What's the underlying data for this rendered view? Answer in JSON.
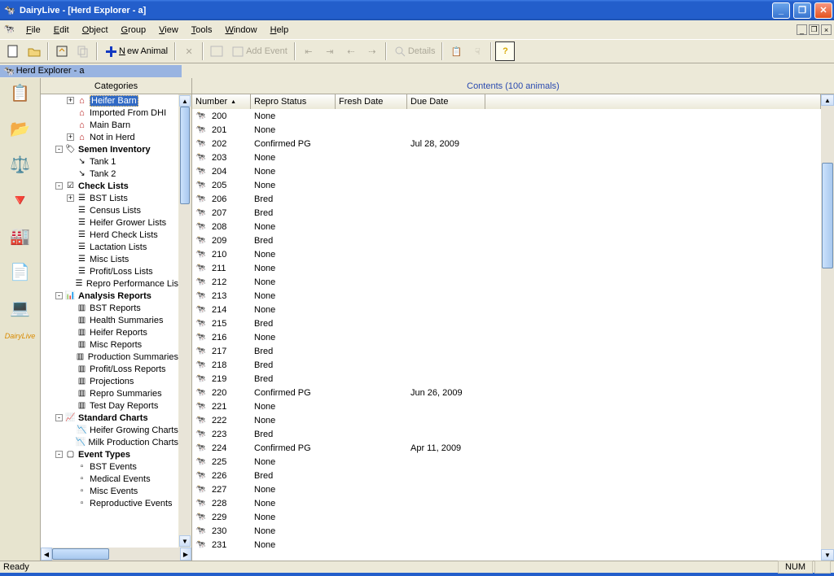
{
  "window": {
    "title": "DairyLive - [Herd Explorer - a]"
  },
  "menu": {
    "file": "File",
    "edit": "Edit",
    "object": "Object",
    "group": "Group",
    "view": "View",
    "tools": "Tools",
    "window": "Window",
    "help": "Help"
  },
  "toolbar": {
    "new_animal": "New Animal",
    "add_event": "Add Event",
    "details": "Details"
  },
  "doc": {
    "tab_title": "Herd Explorer - a"
  },
  "leftbar": {
    "label": "DairyLive"
  },
  "categories": {
    "header": "Categories",
    "nodes": [
      {
        "depth": 2,
        "exp": "+",
        "icon": "barn",
        "label": "Heifer Barn",
        "sel": true
      },
      {
        "depth": 2,
        "exp": "",
        "icon": "barn",
        "label": "Imported From DHI"
      },
      {
        "depth": 2,
        "exp": "",
        "icon": "barn",
        "label": "Main Barn"
      },
      {
        "depth": 2,
        "exp": "+",
        "icon": "barn",
        "label": "Not in Herd"
      },
      {
        "depth": 1,
        "exp": "-",
        "icon": "tag",
        "label": "Semen Inventory",
        "bold": true
      },
      {
        "depth": 2,
        "exp": "",
        "icon": "tank",
        "label": "Tank 1"
      },
      {
        "depth": 2,
        "exp": "",
        "icon": "tank",
        "label": "Tank 2"
      },
      {
        "depth": 1,
        "exp": "-",
        "icon": "check",
        "label": "Check Lists",
        "bold": true
      },
      {
        "depth": 2,
        "exp": "+",
        "icon": "list",
        "label": "BST Lists"
      },
      {
        "depth": 2,
        "exp": "",
        "icon": "list",
        "label": "Census Lists"
      },
      {
        "depth": 2,
        "exp": "",
        "icon": "list",
        "label": "Heifer Grower Lists"
      },
      {
        "depth": 2,
        "exp": "",
        "icon": "list",
        "label": "Herd Check Lists"
      },
      {
        "depth": 2,
        "exp": "",
        "icon": "list",
        "label": "Lactation Lists"
      },
      {
        "depth": 2,
        "exp": "",
        "icon": "list",
        "label": "Misc Lists"
      },
      {
        "depth": 2,
        "exp": "",
        "icon": "list",
        "label": "Profit/Loss Lists"
      },
      {
        "depth": 2,
        "exp": "",
        "icon": "list",
        "label": "Repro Performance Lis"
      },
      {
        "depth": 1,
        "exp": "-",
        "icon": "report",
        "label": "Analysis Reports",
        "bold": true
      },
      {
        "depth": 2,
        "exp": "",
        "icon": "rep",
        "label": "BST Reports"
      },
      {
        "depth": 2,
        "exp": "",
        "icon": "rep",
        "label": "Health Summaries"
      },
      {
        "depth": 2,
        "exp": "",
        "icon": "rep",
        "label": "Heifer Reports"
      },
      {
        "depth": 2,
        "exp": "",
        "icon": "rep",
        "label": "Misc Reports"
      },
      {
        "depth": 2,
        "exp": "",
        "icon": "rep",
        "label": "Production Summaries"
      },
      {
        "depth": 2,
        "exp": "",
        "icon": "rep",
        "label": "Profit/Loss Reports"
      },
      {
        "depth": 2,
        "exp": "",
        "icon": "rep",
        "label": "Projections"
      },
      {
        "depth": 2,
        "exp": "",
        "icon": "rep",
        "label": "Repro Summaries"
      },
      {
        "depth": 2,
        "exp": "",
        "icon": "rep",
        "label": "Test Day Reports"
      },
      {
        "depth": 1,
        "exp": "-",
        "icon": "chart",
        "label": "Standard Charts",
        "bold": true
      },
      {
        "depth": 2,
        "exp": "",
        "icon": "ch",
        "label": "Heifer Growing Charts"
      },
      {
        "depth": 2,
        "exp": "",
        "icon": "ch",
        "label": "Milk Production Charts"
      },
      {
        "depth": 1,
        "exp": "-",
        "icon": "event",
        "label": "Event Types",
        "bold": true
      },
      {
        "depth": 2,
        "exp": "",
        "icon": "ev",
        "label": "BST Events"
      },
      {
        "depth": 2,
        "exp": "",
        "icon": "ev",
        "label": "Medical Events"
      },
      {
        "depth": 2,
        "exp": "",
        "icon": "ev",
        "label": "Misc Events"
      },
      {
        "depth": 2,
        "exp": "",
        "icon": "ev",
        "label": "Reproductive Events"
      }
    ]
  },
  "contents": {
    "header": "Contents (100 animals)",
    "columns": [
      {
        "label": "Number",
        "width": 72,
        "sort": true
      },
      {
        "label": "Repro Status",
        "width": 104
      },
      {
        "label": "Fresh Date",
        "width": 88
      },
      {
        "label": "Due Date",
        "width": 96
      }
    ],
    "rows": [
      {
        "num": "200",
        "repro": "None",
        "fresh": "",
        "due": ""
      },
      {
        "num": "201",
        "repro": "None",
        "fresh": "",
        "due": ""
      },
      {
        "num": "202",
        "repro": "Confirmed PG",
        "fresh": "",
        "due": "Jul 28, 2009"
      },
      {
        "num": "203",
        "repro": "None",
        "fresh": "",
        "due": ""
      },
      {
        "num": "204",
        "repro": "None",
        "fresh": "",
        "due": ""
      },
      {
        "num": "205",
        "repro": "None",
        "fresh": "",
        "due": ""
      },
      {
        "num": "206",
        "repro": "Bred",
        "fresh": "",
        "due": ""
      },
      {
        "num": "207",
        "repro": "Bred",
        "fresh": "",
        "due": ""
      },
      {
        "num": "208",
        "repro": "None",
        "fresh": "",
        "due": ""
      },
      {
        "num": "209",
        "repro": "Bred",
        "fresh": "",
        "due": ""
      },
      {
        "num": "210",
        "repro": "None",
        "fresh": "",
        "due": ""
      },
      {
        "num": "211",
        "repro": "None",
        "fresh": "",
        "due": ""
      },
      {
        "num": "212",
        "repro": "None",
        "fresh": "",
        "due": ""
      },
      {
        "num": "213",
        "repro": "None",
        "fresh": "",
        "due": ""
      },
      {
        "num": "214",
        "repro": "None",
        "fresh": "",
        "due": ""
      },
      {
        "num": "215",
        "repro": "Bred",
        "fresh": "",
        "due": ""
      },
      {
        "num": "216",
        "repro": "None",
        "fresh": "",
        "due": ""
      },
      {
        "num": "217",
        "repro": "Bred",
        "fresh": "",
        "due": ""
      },
      {
        "num": "218",
        "repro": "Bred",
        "fresh": "",
        "due": ""
      },
      {
        "num": "219",
        "repro": "Bred",
        "fresh": "",
        "due": ""
      },
      {
        "num": "220",
        "repro": "Confirmed PG",
        "fresh": "",
        "due": "Jun 26, 2009"
      },
      {
        "num": "221",
        "repro": "None",
        "fresh": "",
        "due": ""
      },
      {
        "num": "222",
        "repro": "None",
        "fresh": "",
        "due": ""
      },
      {
        "num": "223",
        "repro": "Bred",
        "fresh": "",
        "due": ""
      },
      {
        "num": "224",
        "repro": "Confirmed PG",
        "fresh": "",
        "due": "Apr 11, 2009"
      },
      {
        "num": "225",
        "repro": "None",
        "fresh": "",
        "due": ""
      },
      {
        "num": "226",
        "repro": "Bred",
        "fresh": "",
        "due": ""
      },
      {
        "num": "227",
        "repro": "None",
        "fresh": "",
        "due": ""
      },
      {
        "num": "228",
        "repro": "None",
        "fresh": "",
        "due": ""
      },
      {
        "num": "229",
        "repro": "None",
        "fresh": "",
        "due": ""
      },
      {
        "num": "230",
        "repro": "None",
        "fresh": "",
        "due": ""
      },
      {
        "num": "231",
        "repro": "None",
        "fresh": "",
        "due": ""
      }
    ]
  },
  "status": {
    "ready": "Ready",
    "num": "NUM"
  }
}
